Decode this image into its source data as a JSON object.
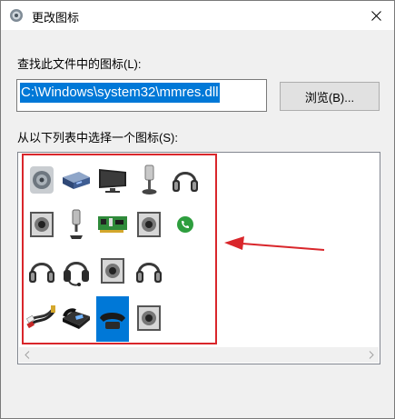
{
  "window": {
    "title": "更改图标"
  },
  "label_find": "查找此文件中的图标(L):",
  "path_value": "C:\\Windows\\system32\\mmres.dll",
  "browse_label": "浏览(B)...",
  "label_select": "从以下列表中选择一个图标(S):",
  "icons": [
    [
      "speaker-icon",
      "set-top-box-icon",
      "monitor-icon",
      "microphone-stand-icon",
      "headphones-icon"
    ],
    [
      "speaker-box-icon",
      "microphone-icon",
      "sound-card-icon",
      "speaker-box-icon",
      "phone-green-icon"
    ],
    [
      "headphones-icon",
      "headset-mic-icon",
      "speaker-box-icon",
      "headphones-icon"
    ],
    [
      "audio-cable-icon",
      "desk-phone-icon",
      "handset-icon",
      "speaker-box-icon"
    ]
  ],
  "selected_icon": "handset-icon",
  "colors": {
    "selection": "#0078d7",
    "annotation": "#d9262b",
    "phone_green": "#2e9e3e"
  }
}
